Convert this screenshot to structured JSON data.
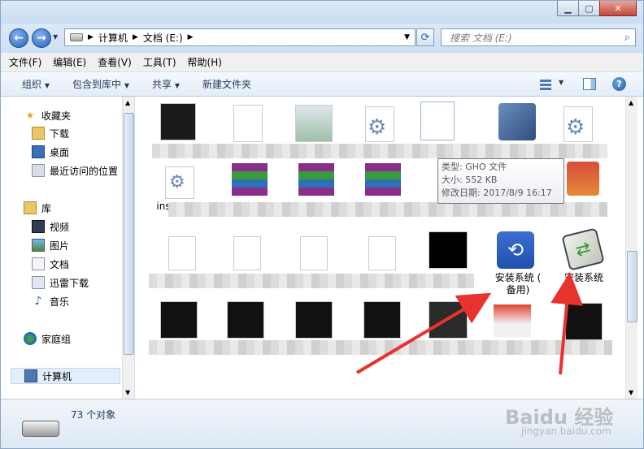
{
  "breadcrumb": {
    "computer": "计算机",
    "drive": "文档 (E:)"
  },
  "search": {
    "placeholder": "搜索 文档 (E:)"
  },
  "menu": [
    "文件(F)",
    "编辑(E)",
    "查看(V)",
    "工具(T)",
    "帮助(H)"
  ],
  "toolbar": {
    "organize": "组织",
    "include": "包含到库中",
    "share": "共享",
    "new_folder": "新建文件夹"
  },
  "sidebar": {
    "favorites": "收藏夹",
    "favorites_items": [
      "下载",
      "桌面",
      "最近访问的位置"
    ],
    "libraries": "库",
    "library_items": [
      "视频",
      "图片",
      "文档",
      "迅雷下载",
      "音乐"
    ],
    "homegroup": "家庭组",
    "computer": "计算机"
  },
  "tooltip": {
    "type": "类型: GHO 文件",
    "size": "大小: 552 KB",
    "modified": "修改日期: 2017/8/9 16:17"
  },
  "files": {
    "ins_label": "ins",
    "install_backup_line1": "安装系统 (",
    "install_backup_line2": "备用)",
    "install_label": "安装系统"
  },
  "status": {
    "count": "73 个对象"
  },
  "watermark": {
    "brand": "Baidu 经验",
    "url": "jingyan.baidu.com"
  },
  "colors": {
    "arrow": "#e8322e",
    "accent": "#1e395b"
  }
}
